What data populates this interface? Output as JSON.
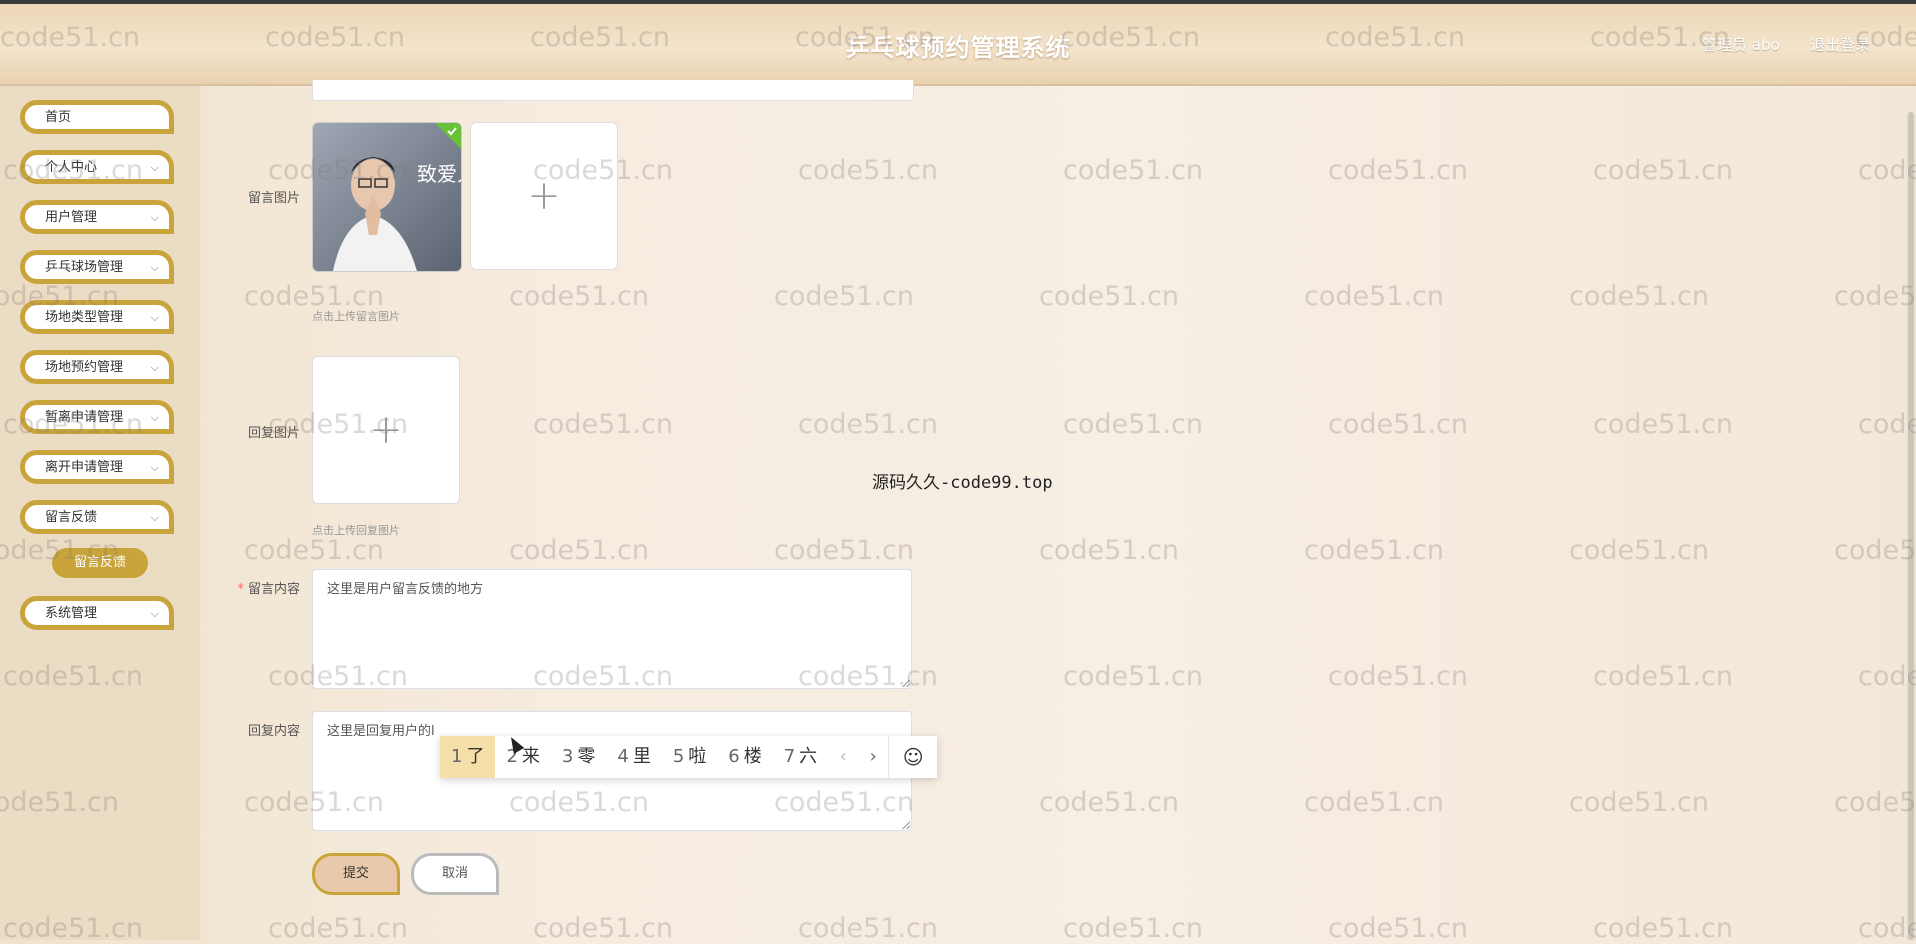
{
  "header": {
    "title": "乒乓球预约管理系统",
    "user_label": "管理员 abo",
    "logout_label": "退出登录"
  },
  "sidebar": {
    "items": [
      {
        "label": "首页",
        "has_chevron": false
      },
      {
        "label": "个人中心",
        "has_chevron": true
      },
      {
        "label": "用户管理",
        "has_chevron": true
      },
      {
        "label": "乒乓球场管理",
        "has_chevron": true
      },
      {
        "label": "场地类型管理",
        "has_chevron": true
      },
      {
        "label": "场地预约管理",
        "has_chevron": true
      },
      {
        "label": "暂离申请管理",
        "has_chevron": true
      },
      {
        "label": "离开申请管理",
        "has_chevron": true
      },
      {
        "label": "留言反馈",
        "has_chevron": true
      },
      {
        "label": "系统管理",
        "has_chevron": true
      }
    ],
    "active_subitem": "留言反馈",
    "chevron_glyph": "⌵"
  },
  "form": {
    "message_image_label": "留言图片",
    "message_image_tip": "点击上传留言图片",
    "reply_image_label": "回复图片",
    "reply_image_tip": "点击上传回复图片",
    "content_label": "留言内容",
    "content_value": "这里是用户留言反馈的地方",
    "reply_label": "回复内容",
    "reply_value": "这里是回复用户的l",
    "upload_plus": "+",
    "thumb_text": "致爱人",
    "submit_label": "提交",
    "cancel_label": "取消"
  },
  "ime": {
    "candidates": [
      {
        "num": "1",
        "text": "了"
      },
      {
        "num": "2",
        "text": "来"
      },
      {
        "num": "3",
        "text": "零"
      },
      {
        "num": "4",
        "text": "里"
      },
      {
        "num": "5",
        "text": "啦"
      },
      {
        "num": "6",
        "text": "楼"
      },
      {
        "num": "7",
        "text": "六"
      }
    ],
    "prev": "‹",
    "next": "›",
    "emoji": "☺"
  },
  "overlay_text": "源码久久-code99.top",
  "watermark_text": "code51.cn",
  "colors": {
    "accent": "#c9a43a",
    "sidebar_bg": "#ebdcc4",
    "ime_selected": "#f5dfa8"
  }
}
